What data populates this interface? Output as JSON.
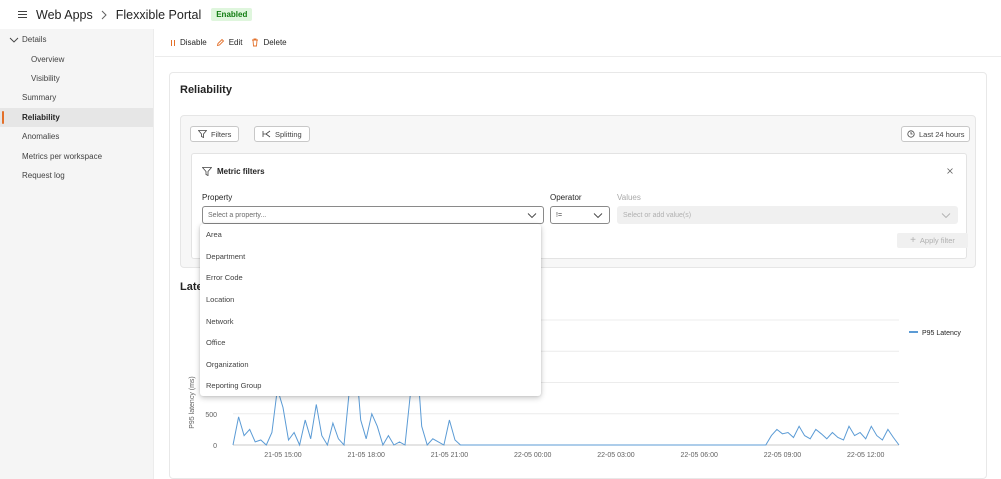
{
  "header": {
    "breadcrumb_root": "Web Apps",
    "title": "Flexxible Portal",
    "status_badge": "Enabled"
  },
  "sidebar": {
    "items": [
      {
        "label": "Details",
        "level": 0,
        "expanded": true
      },
      {
        "label": "Overview",
        "level": 2
      },
      {
        "label": "Visibility",
        "level": 2
      },
      {
        "label": "Summary",
        "level": 1
      },
      {
        "label": "Reliability",
        "level": 1,
        "active": true
      },
      {
        "label": "Anomalies",
        "level": 1
      },
      {
        "label": "Metrics per workspace",
        "level": 1
      },
      {
        "label": "Request log",
        "level": 1
      }
    ]
  },
  "toolbar": {
    "disable_label": "Disable",
    "edit_label": "Edit",
    "delete_label": "Delete"
  },
  "main": {
    "section_title": "Reliability",
    "filters_label": "Filters",
    "splitting_label": "Splitting",
    "time_range_label": "Last 24 hours",
    "metric_filters": {
      "title": "Metric filters",
      "property_label": "Property",
      "property_placeholder": "Select a property...",
      "operator_label": "Operator",
      "operator_value": "!=",
      "values_label": "Values",
      "values_placeholder": "Select or add value(s)",
      "apply_label": "Apply filter"
    },
    "property_options": [
      "Area",
      "Department",
      "Error Code",
      "Location",
      "Network",
      "Office",
      "Organization",
      "Reporting Group"
    ],
    "latency_title_visible": "Late"
  },
  "colors": {
    "accent": "#e3702a",
    "series": "#5b9bd5",
    "badge_bg": "#dff6dd",
    "badge_text": "#107c10"
  },
  "chart_data": {
    "type": "line",
    "ylabel": "P95 latency (ms)",
    "y_ticks": [
      0,
      500
    ],
    "ylim": [
      0,
      2000
    ],
    "x_tick_labels": [
      "21-05 15:00",
      "21-05 18:00",
      "21-05 21:00",
      "22-05 00:00",
      "22-05 03:00",
      "22-05 06:00",
      "22-05 09:00",
      "22-05 12:00"
    ],
    "x_range_hours": [
      13.2,
      37.2
    ],
    "x_tick_hours": [
      15,
      18,
      21,
      24,
      27,
      30,
      33,
      36
    ],
    "grid": true,
    "legend_position": "top-right",
    "series": [
      {
        "name": "P95 Latency",
        "x_hours": [
          13.2,
          13.4,
          13.6,
          13.8,
          14.0,
          14.2,
          14.4,
          14.6,
          14.8,
          15.0,
          15.2,
          15.4,
          15.6,
          15.8,
          16.0,
          16.2,
          16.4,
          16.6,
          16.8,
          17.0,
          17.2,
          17.4,
          17.6,
          17.8,
          18.0,
          18.2,
          18.4,
          18.6,
          18.8,
          19.0,
          19.2,
          19.4,
          19.6,
          19.8,
          20.0,
          20.2,
          20.4,
          20.6,
          20.8,
          21.0,
          21.2,
          21.4,
          21.6,
          21.8,
          22.0,
          22.5,
          23.0,
          24.0,
          26.0,
          28.0,
          30.0,
          31.0,
          32.0,
          32.4,
          32.6,
          32.8,
          33.0,
          33.2,
          33.4,
          33.6,
          33.8,
          34.0,
          34.2,
          34.4,
          34.6,
          34.8,
          35.0,
          35.2,
          35.4,
          35.6,
          35.8,
          36.0,
          36.2,
          36.4,
          36.6,
          36.8,
          37.0,
          37.2
        ],
        "values": [
          0,
          450,
          150,
          250,
          50,
          80,
          0,
          200,
          900,
          600,
          80,
          200,
          0,
          400,
          100,
          650,
          150,
          0,
          350,
          100,
          0,
          900,
          1500,
          400,
          100,
          500,
          300,
          0,
          150,
          0,
          50,
          0,
          850,
          1550,
          300,
          0,
          100,
          50,
          0,
          400,
          80,
          0,
          0,
          0,
          0,
          0,
          0,
          0,
          0,
          0,
          0,
          0,
          0,
          0,
          150,
          250,
          180,
          200,
          120,
          300,
          150,
          100,
          250,
          180,
          100,
          200,
          120,
          80,
          300,
          150,
          200,
          100,
          300,
          150,
          80,
          250,
          120,
          0
        ]
      }
    ]
  }
}
